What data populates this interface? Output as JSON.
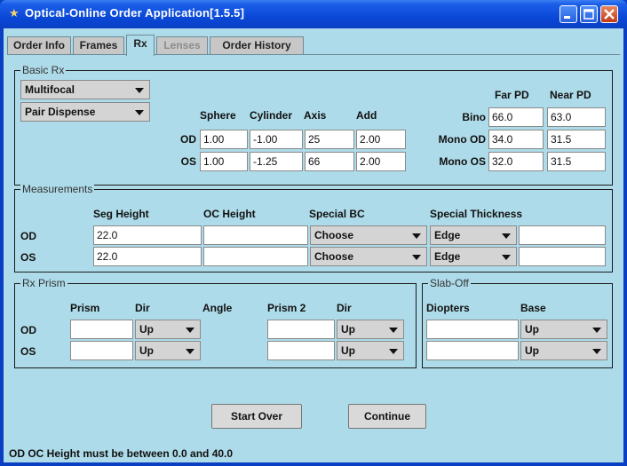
{
  "window": {
    "title": "Optical-Online Order Application[1.5.5]",
    "colors": {
      "titlebar": "#0a3fc4",
      "client_bg": "#aedbe9"
    }
  },
  "tabs": [
    {
      "label": "Order Info",
      "state": "normal"
    },
    {
      "label": "Frames",
      "state": "normal"
    },
    {
      "label": "Rx",
      "state": "selected"
    },
    {
      "label": "Lenses",
      "state": "disabled"
    },
    {
      "label": "Order History",
      "state": "normal"
    }
  ],
  "basic_rx": {
    "group_title": "Basic Rx",
    "lens_type": "Multifocal",
    "dispense": "Pair Dispense",
    "headers": {
      "sphere": "Sphere",
      "cylinder": "Cylinder",
      "axis": "Axis",
      "add": "Add"
    },
    "od": {
      "label": "OD",
      "sphere": "1.00",
      "cylinder": "-1.00",
      "axis": "25",
      "add": "2.00"
    },
    "os": {
      "label": "OS",
      "sphere": "1.00",
      "cylinder": "-1.25",
      "axis": "66",
      "add": "2.00"
    },
    "pd": {
      "far_label": "Far PD",
      "near_label": "Near PD",
      "bino": {
        "label": "Bino",
        "far": "66.0",
        "near": "63.0"
      },
      "mono_od": {
        "label": "Mono OD",
        "far": "34.0",
        "near": "31.5"
      },
      "mono_os": {
        "label": "Mono OS",
        "far": "32.0",
        "near": "31.5"
      }
    }
  },
  "measurements": {
    "group_title": "Measurements",
    "headers": {
      "seg_height": "Seg Height",
      "oc_height": "OC Height",
      "special_bc": "Special BC",
      "special_thickness": "Special Thickness"
    },
    "od": {
      "label": "OD",
      "seg_height": "22.0",
      "oc_height": "",
      "special_bc": "Choose",
      "thickness_type": "Edge",
      "thickness_value": ""
    },
    "os": {
      "label": "OS",
      "seg_height": "22.0",
      "oc_height": "",
      "special_bc": "Choose",
      "thickness_type": "Edge",
      "thickness_value": ""
    }
  },
  "rx_prism": {
    "group_title": "Rx Prism",
    "headers": {
      "prism": "Prism",
      "dir": "Dir",
      "angle": "Angle",
      "prism2": "Prism 2",
      "dir2": "Dir"
    },
    "od": {
      "label": "OD",
      "prism": "",
      "dir": "Up",
      "prism2": "",
      "dir2": "Up"
    },
    "os": {
      "label": "OS",
      "prism": "",
      "dir": "Up",
      "prism2": "",
      "dir2": "Up"
    }
  },
  "slab_off": {
    "group_title": "Slab-Off",
    "headers": {
      "diopters": "Diopters",
      "base": "Base"
    },
    "od": {
      "diopters": "",
      "base": "Up"
    },
    "os": {
      "diopters": "",
      "base": "Up"
    }
  },
  "buttons": {
    "start_over": "Start Over",
    "continue": "Continue"
  },
  "status": "OD OC Height must be between 0.0 and 40.0"
}
